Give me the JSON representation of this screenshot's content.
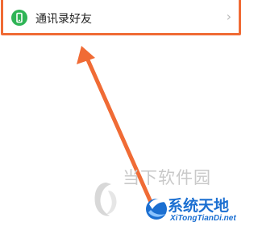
{
  "contact_row": {
    "label": "通讯录好友",
    "icon": "phone-icon",
    "chevron": "›"
  },
  "colors": {
    "highlight": "#f06b35",
    "icon_bg": "#2fb456",
    "watermark_brand": "#1b6fd1"
  },
  "watermarks": {
    "site_text": "当下软件园",
    "brand_name": "系统天地",
    "brand_url": "XiTongTianDi.net"
  }
}
